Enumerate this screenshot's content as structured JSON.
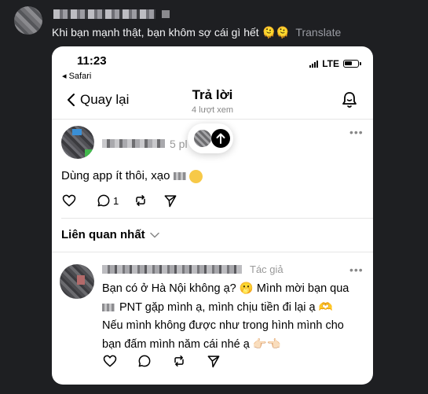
{
  "message": {
    "text": "Khi bạn mạnh thật, bạn khôm sợ cái gì hết 🫠🫠",
    "translate": "Translate"
  },
  "status_bar": {
    "time": "11:23",
    "back_app": "◂ Safari",
    "network": "LTE"
  },
  "nav": {
    "back_label": "Quay lại",
    "title": "Trả lời",
    "subtitle": "4 lượt xem"
  },
  "reply": {
    "time": "5 pl",
    "text_before": "Dùng app ít thôi, xạo",
    "like_icon": "heart-icon",
    "comment_count": "1",
    "repost_icon": "repost-icon",
    "share_icon": "send-icon"
  },
  "related": {
    "label": "Liên quan nhất"
  },
  "author_reply": {
    "tag": "Tác giả",
    "line1": "Bạn có ở Hà Nội không ạ? 🫢 Mình mời bạn qua",
    "line2": "PNT gặp mình ạ, mình chịu tiền đi lại ạ 🫶",
    "line3": "Nếu mình không được như trong hình mình cho",
    "line4": "bạn đấm mình năm cái nhé ạ 👉🏻👈🏻"
  }
}
